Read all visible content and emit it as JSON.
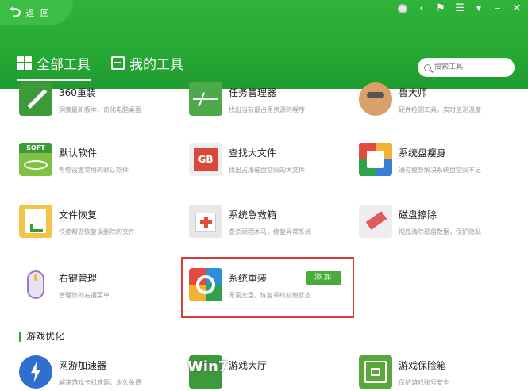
{
  "header": {
    "back_label": "返 回",
    "tabs": [
      {
        "label": "全部工具",
        "icon": "grid-icon",
        "active": true
      },
      {
        "label": "我的工具",
        "icon": "my-tools-icon",
        "active": false
      }
    ],
    "search_placeholder": "搜索工具"
  },
  "colors": {
    "brand_green": "#26a834",
    "highlight_red": "#d93a3a",
    "add_button": "#4aaa3c"
  },
  "tools": [
    {
      "name": "360重装",
      "desc": "洞察最新版本，奇化电脑桌面",
      "icon": "pencil-icon"
    },
    {
      "name": "任务管理器",
      "desc": "找出当前最占用资源的程序",
      "icon": "task-monitor-icon"
    },
    {
      "name": "鲁大师",
      "desc": "硬件检测工具，实时监测温度",
      "icon": "ludashi-icon"
    },
    {
      "name": "默认软件",
      "desc": "帮您设置常用的默认软件",
      "icon": "soft-icon"
    },
    {
      "name": "查找大文件",
      "desc": "找出占用磁盘空间的大文件",
      "icon": "gb-file-icon"
    },
    {
      "name": "系统盘瘦身",
      "desc": "通过瘦身解决系统盘空间不足",
      "icon": "disk-slim-icon"
    },
    {
      "name": "文件恢复",
      "desc": "快速帮您恢复误删除的文件",
      "icon": "file-restore-icon"
    },
    {
      "name": "系统急救箱",
      "desc": "查杀顽固木马，修复异常系统",
      "icon": "first-aid-icon"
    },
    {
      "name": "磁盘擦除",
      "desc": "彻底清除磁盘数据，保护隐私",
      "icon": "eraser-icon"
    },
    {
      "name": "右键管理",
      "desc": "管理您的右键菜单",
      "icon": "mouse-icon"
    },
    {
      "name": "系统重装",
      "desc": "无需光盘，恢复系统初始状态",
      "icon": "reinstall-icon",
      "button": "添加"
    },
    {
      "name": "网游加速器",
      "desc": "解决游戏卡机难题，永久免费",
      "icon": "lightning-icon"
    },
    {
      "name": "游戏大厅",
      "desc": "",
      "icon": "game-hall-icon"
    },
    {
      "name": "游戏保险箱",
      "desc": "保护游戏账号安全",
      "icon": "safe-box-icon"
    }
  ],
  "section_game": "游戏优化",
  "watermark": "Win7"
}
